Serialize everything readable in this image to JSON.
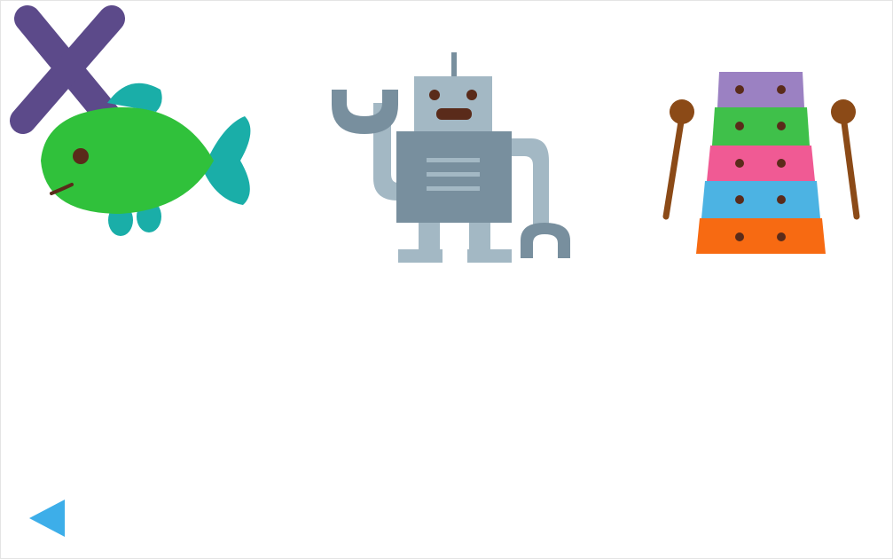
{
  "choices": [
    {
      "icon": "fish-icon"
    },
    {
      "icon": "robot-icon"
    },
    {
      "icon": "xylophone-icon"
    }
  ],
  "target_letter": {
    "letter": "X",
    "color": "#5c4a8a"
  },
  "back_button": {
    "icon": "back-arrow-icon",
    "color": "#3daee9"
  },
  "colors": {
    "fish_body": "#30c13b",
    "fish_fins": "#1aaea8",
    "robot_body": "#788f9e",
    "robot_limbs": "#a3b8c4",
    "xylophone_bars": [
      "#9b81c2",
      "#3fc04a",
      "#f05a94",
      "#4cb3e3",
      "#f76a12"
    ],
    "mallet": "#8b4a17"
  }
}
